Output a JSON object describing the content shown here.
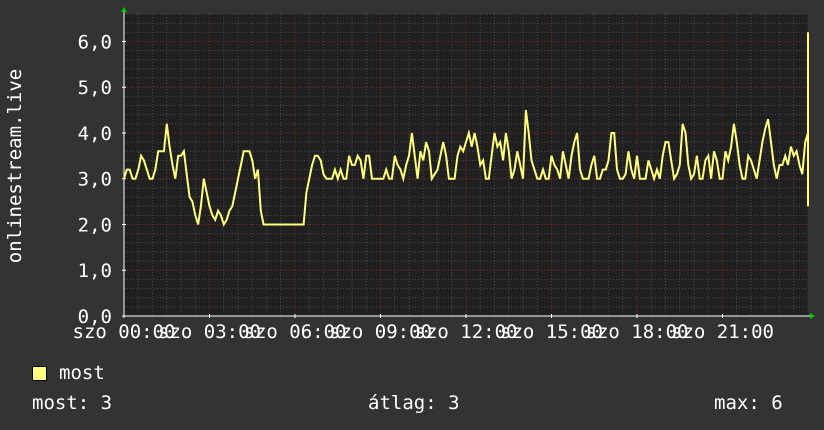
{
  "colors": {
    "background": "#333333",
    "plot_bg": "#202020",
    "grid_major": "#8a2020",
    "grid_minor": "#4a4a4a",
    "line": "#ffff80",
    "axis": "#ffffff",
    "arrow": "#00cc00"
  },
  "chart_data": {
    "type": "line",
    "ylabel": "onlinestream.live",
    "ylim": [
      0,
      6.6
    ],
    "yticks": [
      0,
      1,
      2,
      3,
      4,
      5,
      6
    ],
    "ytick_labels": [
      "0,0",
      "1,0",
      "2,0",
      "3,0",
      "4,0",
      "5,0",
      "6,0"
    ],
    "xlim_hours": [
      0,
      24
    ],
    "xtick_hours": [
      0,
      3,
      6,
      9,
      12,
      15,
      18,
      21
    ],
    "xtick_labels": [
      "szo 00:00",
      "szo 03:00",
      "szo 06:00",
      "szo 09:00",
      "szo 12:00",
      "szo 15:00",
      "szo 18:00",
      "szo 21:00"
    ],
    "grid": true,
    "series": [
      {
        "name": "most",
        "color": "#ffff80",
        "t0_hours": 0,
        "step_hours": 0.1,
        "values": [
          3,
          3.2,
          3.2,
          3,
          3,
          3.2,
          3.5,
          3.4,
          3.2,
          3,
          3,
          3.2,
          3.6,
          3.6,
          3.6,
          4.2,
          3.7,
          3.3,
          3,
          3.5,
          3.5,
          3.6,
          3.1,
          2.6,
          2.5,
          2.2,
          2.0,
          2.4,
          3.0,
          2.7,
          2.4,
          2.2,
          2.1,
          2.3,
          2.2,
          2.0,
          2.1,
          2.3,
          2.4,
          2.7,
          3.0,
          3.3,
          3.6,
          3.6,
          3.6,
          3.4,
          3.0,
          3.2,
          2.3,
          2.0,
          2.0,
          2.0,
          2.0,
          2.0,
          2.0,
          2.0,
          2.0,
          2.0,
          2.0,
          2.0,
          2.0,
          2.0,
          2.0,
          2.0,
          2.7,
          3.0,
          3.3,
          3.5,
          3.5,
          3.4,
          3.1,
          3.0,
          3.0,
          3.0,
          3.2,
          3.0,
          3.2,
          3.0,
          3.0,
          3.5,
          3.3,
          3.3,
          3.5,
          3.4,
          3.0,
          3.5,
          3.5,
          3.0,
          3.0,
          3.0,
          3.0,
          3.0,
          3.2,
          3.0,
          3.0,
          3.5,
          3.3,
          3.2,
          3.0,
          3.3,
          3.5,
          4.0,
          3.5,
          3.0,
          3.6,
          3.4,
          3.8,
          3.6,
          3.0,
          3.1,
          3.2,
          3.5,
          3.8,
          3.5,
          3.0,
          3.0,
          3.0,
          3.5,
          3.7,
          3.6,
          3.8,
          4.0,
          3.7,
          4.0,
          3.7,
          3.3,
          3.4,
          3.0,
          3.0,
          3.5,
          4.0,
          3.7,
          3.8,
          3.4,
          4.0,
          3.6,
          3.0,
          3.2,
          3.6,
          3.3,
          3.0,
          4.5,
          4.0,
          3.4,
          3.2,
          3.0,
          3.0,
          3.2,
          3.0,
          3.0,
          3.5,
          3.3,
          3.2,
          3.0,
          3.6,
          3.3,
          3.0,
          3.5,
          3.8,
          4.0,
          3.2,
          3.0,
          3.0,
          3.0,
          3.3,
          3.5,
          3.0,
          3.0,
          3.2,
          3.2,
          3.4,
          4.0,
          4.0,
          3.2,
          3.0,
          3.0,
          3.1,
          3.6,
          3.2,
          3.0,
          3.5,
          3.0,
          3.0,
          3.0,
          3.4,
          3.2,
          3.0,
          3.2,
          3.0,
          3.5,
          3.8,
          3.8,
          3.4,
          3.0,
          3.1,
          3.3,
          4.2,
          4.0,
          3.3,
          3.0,
          3.1,
          3.5,
          3.0,
          3.0,
          3.4,
          3.5,
          3.0,
          3.6,
          3.4,
          3.0,
          3.0,
          3.6,
          3.4,
          3.7,
          4.2,
          3.8,
          3.3,
          3.0,
          3.0,
          3.5,
          3.4,
          3.2,
          3.0,
          3.4,
          3.8,
          4.1,
          4.3,
          3.8,
          3.3,
          3.0,
          3.3,
          3.3,
          3.5,
          3.3,
          3.7,
          3.5,
          3.6,
          3.3,
          3.1,
          3.8,
          4.0,
          3.8,
          3.4,
          3.0,
          3.2,
          3.6,
          3.3,
          3.0,
          3.0,
          3.1,
          3.3,
          3.0,
          3.2,
          3.4,
          3.6,
          3.8,
          3.9,
          3.8,
          3.5,
          3.0,
          3.4,
          3.3,
          3.0,
          3.0,
          3.2,
          3.3,
          3.6,
          3.3,
          3.0,
          3.3,
          3.4,
          3.5,
          3.5,
          3.6,
          3.7,
          4.0,
          3.8,
          3.3,
          3.0,
          3.3,
          3.5,
          3.8,
          3.4,
          3.0,
          3.0,
          3.2,
          3.3,
          3.5,
          3.6,
          3.6,
          3.8,
          3.4,
          3.2,
          3.0,
          3.3,
          3.3,
          3.5,
          3.6,
          3.4,
          3.2,
          3.5,
          3.2,
          3.0,
          3.3,
          3.8,
          4.0,
          3.6,
          3.2,
          3.0,
          3.2,
          3.4,
          3.3,
          3.0,
          3.6,
          3.8,
          3.4,
          3.2,
          3.4,
          3.7,
          3.5,
          3.0,
          3.2,
          3.6,
          3.8,
          3.6,
          3.4,
          3.0,
          3.1,
          3.0,
          3.5,
          3.2,
          3.1,
          3.3,
          3.4,
          3.6,
          3.6,
          3.3,
          3.0,
          3.1,
          3.3,
          3.4,
          3.5,
          3.5,
          3.4,
          3.3,
          3.6,
          3.8,
          3.6,
          3.4,
          3.2,
          3.0,
          3.3,
          3.5,
          3.8,
          4.0,
          3.5,
          3.3,
          3.0,
          3.1,
          3.0,
          3.2,
          3.4,
          3.6,
          3.4,
          3.1,
          3.3,
          3.6,
          3.5,
          3.2,
          3.0,
          3.4,
          3.6,
          3.4,
          3.0,
          3.2,
          3.5,
          4.2,
          4.1,
          4.4,
          5.8,
          5.4,
          5.9,
          6.2,
          5.6,
          4.4,
          5.5,
          5.0,
          5.3,
          5.9,
          6.0,
          5.6,
          4.8,
          4.2,
          3.5,
          3.8,
          3.5,
          3.4,
          3.2,
          3.0,
          3.0,
          3.0,
          3.0,
          3.0,
          3.0,
          3.0,
          3.0,
          3.2,
          3.5,
          3.4,
          3.4,
          3.5,
          3.5,
          3.3,
          3.3,
          3.1,
          3.0,
          3.0,
          3.0,
          3.0,
          3.0,
          3.3,
          3.5,
          3.0,
          3.1,
          3.0,
          3.0,
          3.0,
          3.0,
          3.1,
          3.3,
          2.9,
          2.7,
          2.4,
          3.0,
          3.5,
          3.3,
          3.1,
          3.4,
          3.5,
          3.5,
          3.2,
          3.1,
          3.0,
          3.0,
          3.5,
          3.7,
          3.4,
          3.2,
          3.0,
          3.0,
          3.0,
          3.1,
          3.2,
          3.3,
          3.6,
          3.6,
          3.4,
          3.1,
          3.0,
          3.5,
          3.8,
          4.0,
          3.4,
          3.0,
          3.1,
          3.5,
          4.4,
          4.5,
          3.9,
          3.5,
          3.2,
          3.0,
          3.0,
          3.0,
          3.1,
          3.3,
          3.6,
          4.1,
          4.6,
          4.2,
          3.6,
          3.1,
          3.3,
          3.6,
          3.5,
          3.6,
          3.5,
          3.2,
          3.0,
          3.1,
          3.5,
          3.6,
          3.6,
          3.3,
          3.0,
          3.1,
          3.2,
          3.4,
          3.6,
          3.7,
          3.7,
          3.5,
          3.3,
          3.4,
          3.5,
          3.7,
          4.0,
          3.8,
          3.5,
          3.4,
          3.6,
          3.6,
          3.4,
          3.1,
          3.0,
          3.2,
          3.4,
          3.8,
          3.7,
          3.5,
          3.5,
          3.4,
          3.4,
          3.6,
          3.9,
          3.7,
          3.5,
          3.3,
          3.2,
          3.1,
          3.0,
          3.0,
          3.0,
          3.0,
          3.0,
          3.2,
          3.4,
          3.4,
          3.4,
          3.4,
          3.2,
          3.1,
          3.0,
          3.0,
          3.0,
          3.0,
          3.2,
          3.4,
          3.6,
          3.8,
          4.2,
          4.6,
          4.3,
          3.8,
          3.4,
          3.1,
          3.0,
          3.0,
          3.0,
          3.0,
          3.3,
          3.6,
          3.9,
          4.0,
          3.9,
          3.8,
          3.6,
          3.4,
          3.2,
          3.1,
          3.0,
          3.0,
          3.0,
          3.0,
          3.0,
          3.0,
          3.0,
          3.0,
          3.0,
          3.0,
          3.0,
          3.0,
          3.0,
          3.0,
          3.0,
          3.0
        ]
      }
    ]
  },
  "legend": {
    "label": "most"
  },
  "stats": {
    "current": "most: 3",
    "average": "átlag: 3",
    "max": "max: 6"
  }
}
